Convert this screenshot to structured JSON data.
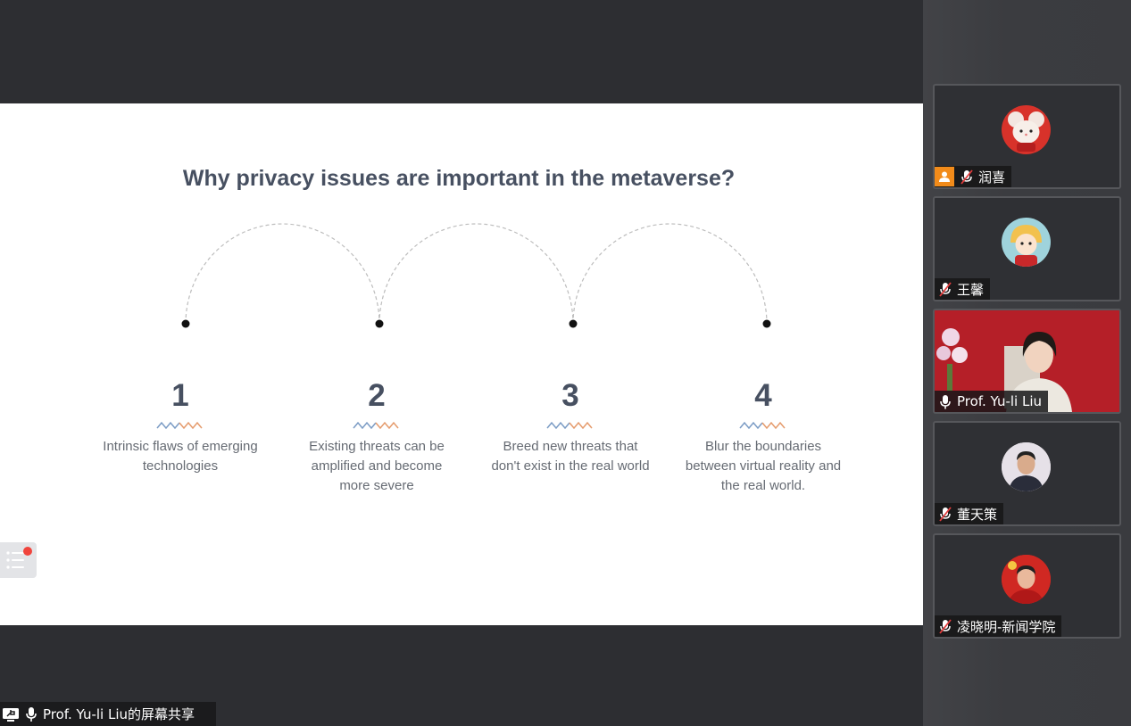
{
  "slide": {
    "title": "Why privacy issues are important in the metaverse?",
    "steps": [
      {
        "number": "1",
        "lines": [
          "Intrinsic flaws of emerging",
          "technologies"
        ]
      },
      {
        "number": "2",
        "lines": [
          "Existing threats can be",
          "amplified and become",
          "more severe"
        ]
      },
      {
        "number": "3",
        "lines": [
          "Breed new threats that",
          "don't exist in the real world"
        ]
      },
      {
        "number": "4",
        "lines": [
          "Blur the boundaries",
          "between virtual reality and",
          "the real world."
        ]
      }
    ]
  },
  "share_bar": {
    "label": "Prof. Yu-li Liu的屏幕共享"
  },
  "participants": [
    {
      "name": "润喜",
      "muted": true,
      "host_badge": true,
      "avatar": "cartoon-mouse-avatar"
    },
    {
      "name": "王馨",
      "muted": true,
      "host_badge": false,
      "avatar": "cartoon-girl-avatar"
    },
    {
      "name": "Prof. Yu-li Liu",
      "muted": false,
      "host_badge": false,
      "avatar": "video-feed"
    },
    {
      "name": "董天策",
      "muted": true,
      "host_badge": false,
      "avatar": "photo-avatar"
    },
    {
      "name": "凌晓明-新闻学院",
      "muted": true,
      "host_badge": false,
      "avatar": "photo-avatar-red"
    }
  ],
  "colors": {
    "title": "#475061",
    "body_text": "#666b73",
    "wave_blue": "#7a9bc4",
    "wave_orange": "#e59a6b",
    "host_badge": "#f28b1a",
    "notification_dot": "#f0443c"
  }
}
